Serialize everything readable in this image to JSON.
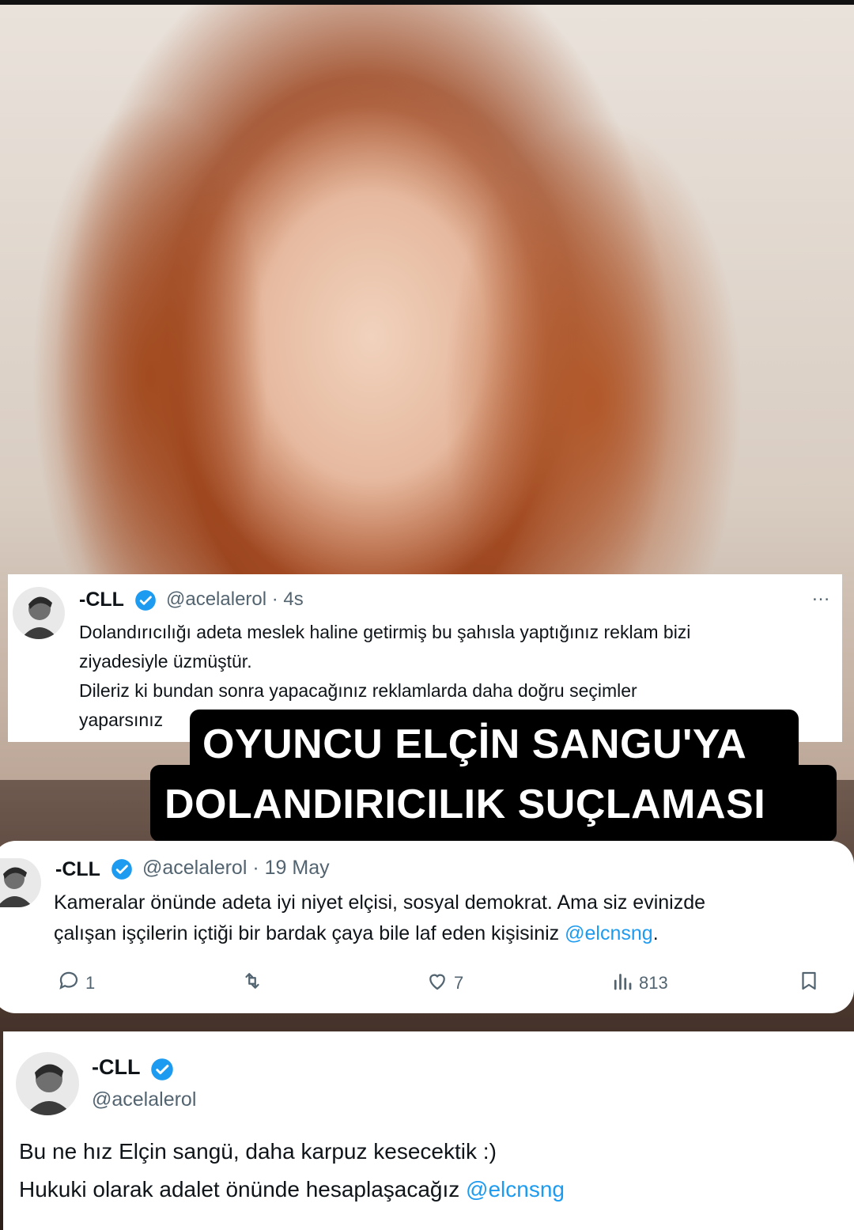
{
  "tweets": [
    {
      "name": "-CLL",
      "handle": "@acelalerol",
      "time": "4s",
      "more": "…",
      "lines": [
        "Dolandırıcılığı adeta meslek haline getirmiş bu şahısla yaptığınız reklam bizi",
        "ziyadesiyle üzmüştür.",
        "Dileriz ki bundan sonra yapacağınız reklamlarda daha doğru seçimler",
        "yaparsınız"
      ]
    },
    {
      "name": "-CLL",
      "handle": "@acelalerol",
      "time": "19 May",
      "lines": [
        "Kameralar önünde adeta iyi niyet elçisi, sosyal demokrat. Ama siz evinizde",
        "çalışan işçilerin içtiği bir bardak çaya bile laf eden kişisiniz"
      ],
      "mention": "@elcnsng",
      "mention_suffix": ".",
      "actions": {
        "replies": "1",
        "likes": "7",
        "views": "813"
      }
    },
    {
      "name": "-CLL",
      "handle": "@acelalerol",
      "lines": [
        "Bu ne hız Elçin sangü, daha karpuz kesecektik :)",
        "Hukuki olarak adalet önünde hesaplaşacağız"
      ],
      "mention": "@elcnsng"
    }
  ],
  "headline": {
    "line1": "OYUNCU ELÇİN SANGU'YA",
    "line2": "DOLANDIRICILIK SUÇLAMASI"
  },
  "colors": {
    "verified": "#1d9bf0",
    "mention": "#1d9bf0",
    "secondary_text": "#536471",
    "headline_bg": "#000000"
  },
  "icons": [
    "verified-badge-icon",
    "more-options-icon",
    "reply-icon",
    "retweet-icon",
    "like-icon",
    "views-icon",
    "bookmark-icon"
  ]
}
